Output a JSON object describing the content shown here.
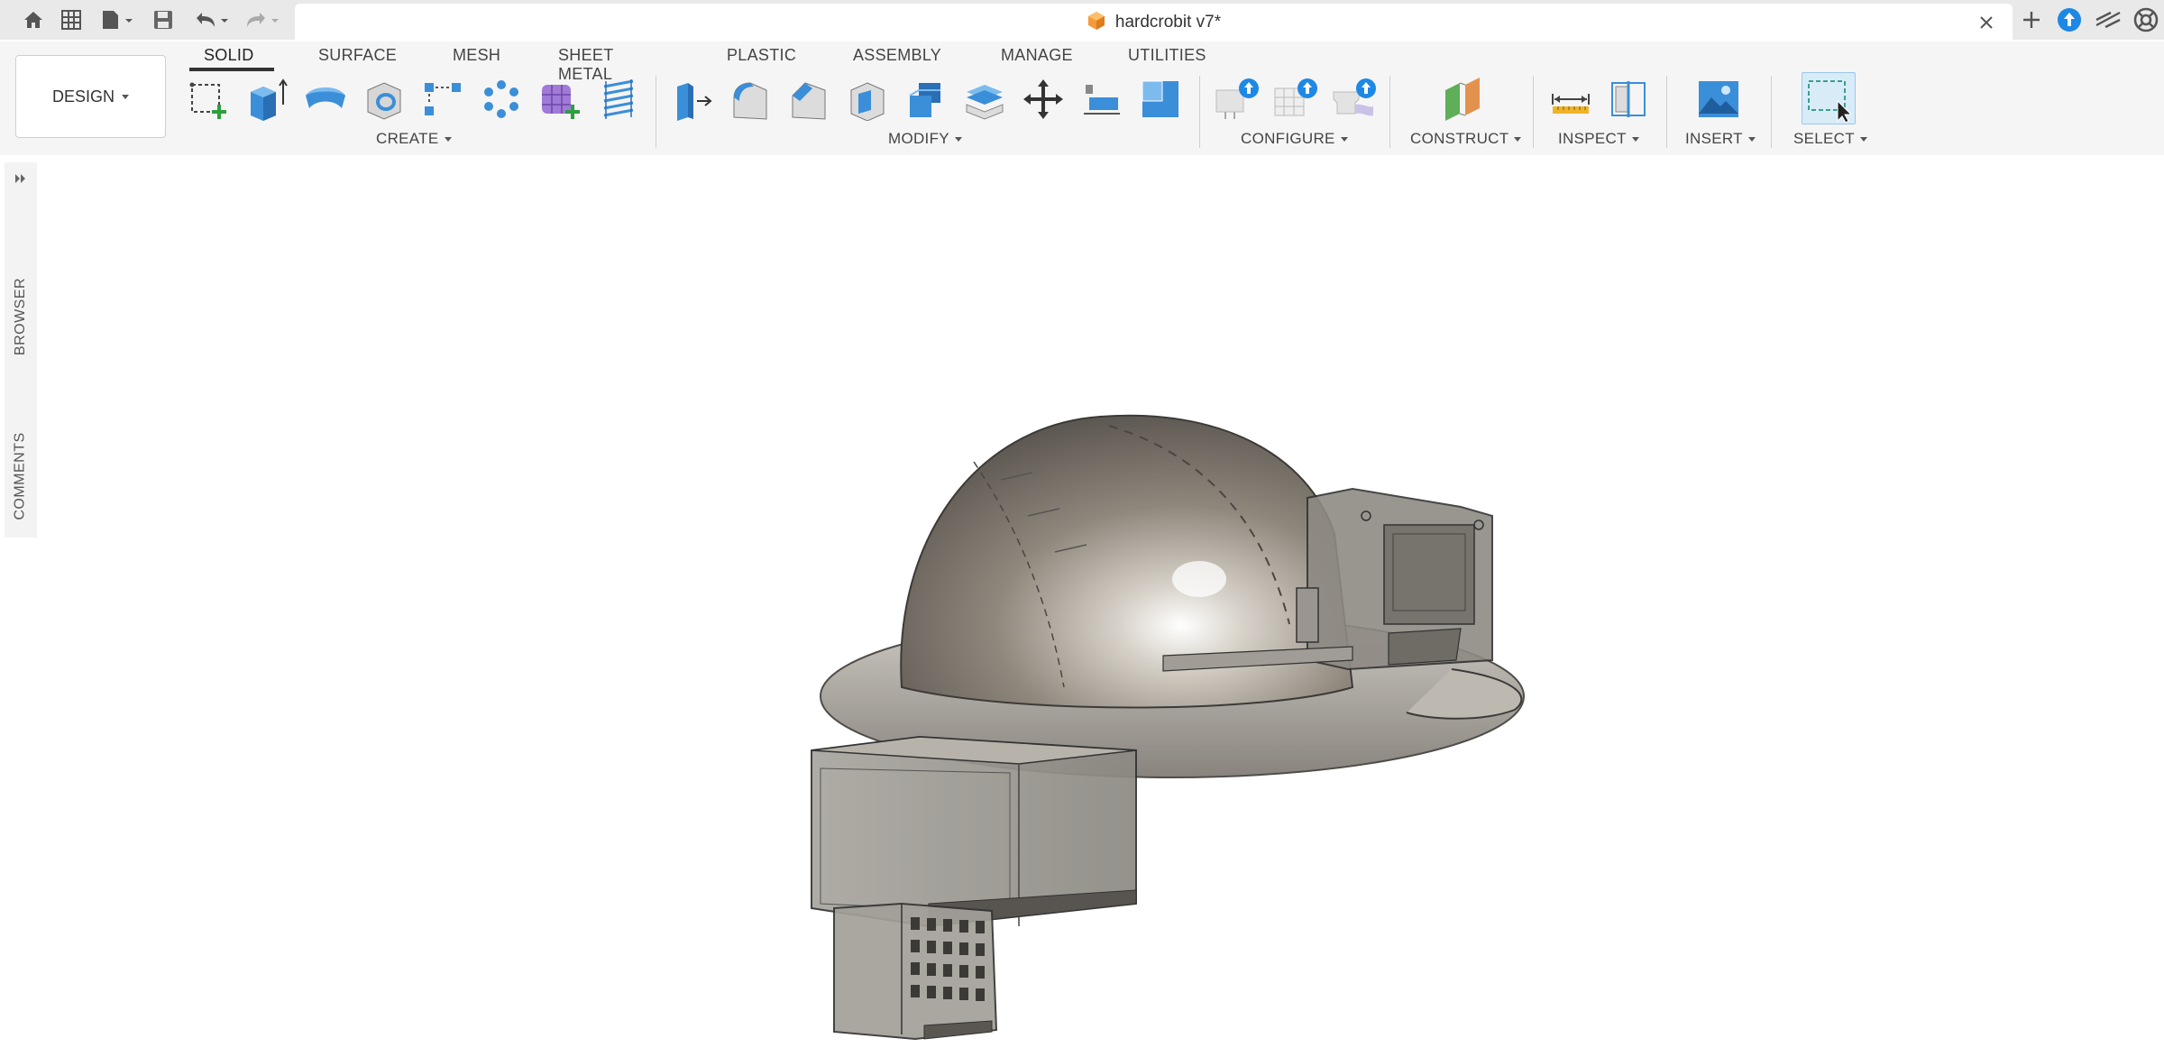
{
  "document": {
    "title": "hardcrobit v7*"
  },
  "workspace": {
    "label": "DESIGN"
  },
  "toolbar": {
    "tabs": [
      {
        "label": "SOLID",
        "active": true
      },
      {
        "label": "SURFACE",
        "active": false
      },
      {
        "label": "MESH",
        "active": false
      },
      {
        "label": "SHEET METAL",
        "active": false
      },
      {
        "label": "PLASTIC",
        "active": false
      },
      {
        "label": "ASSEMBLY",
        "active": false
      },
      {
        "label": "MANAGE",
        "active": false
      },
      {
        "label": "UTILITIES",
        "active": false
      }
    ],
    "groups": {
      "create": "CREATE",
      "modify": "MODIFY",
      "configure": "CONFIGURE",
      "construct": "CONSTRUCT",
      "inspect": "INSPECT",
      "insert": "INSERT",
      "select": "SELECT"
    },
    "icons": {
      "create": [
        "create-sketch-icon",
        "extrude-icon",
        "revolve-icon",
        "hole-icon",
        "rectangular-pattern-icon",
        "circular-pattern-icon",
        "create-form-icon",
        "thread-icon"
      ],
      "modify": [
        "press-pull-icon",
        "fillet-icon",
        "chamfer-icon",
        "shell-icon",
        "combine-icon",
        "offset-face-icon",
        "move-copy-icon",
        "align-icon",
        "scale-icon"
      ],
      "configure": [
        "configure-table-icon",
        "configure-grid-icon",
        "configure-theme-icon"
      ],
      "construct": [
        "construct-plane-icon"
      ],
      "inspect": [
        "measure-icon",
        "section-analysis-icon"
      ],
      "insert": [
        "insert-image-icon"
      ],
      "select": [
        "window-select-icon"
      ]
    }
  },
  "side_panel": {
    "browser": "BROWSER",
    "comments": "COMMENTS"
  },
  "colors": {
    "accent_blue": "#1e88e5",
    "title_bg": "#e9e9e9",
    "toolbar_bg": "#f5f5f5",
    "model_gray": "#8c8a84"
  }
}
